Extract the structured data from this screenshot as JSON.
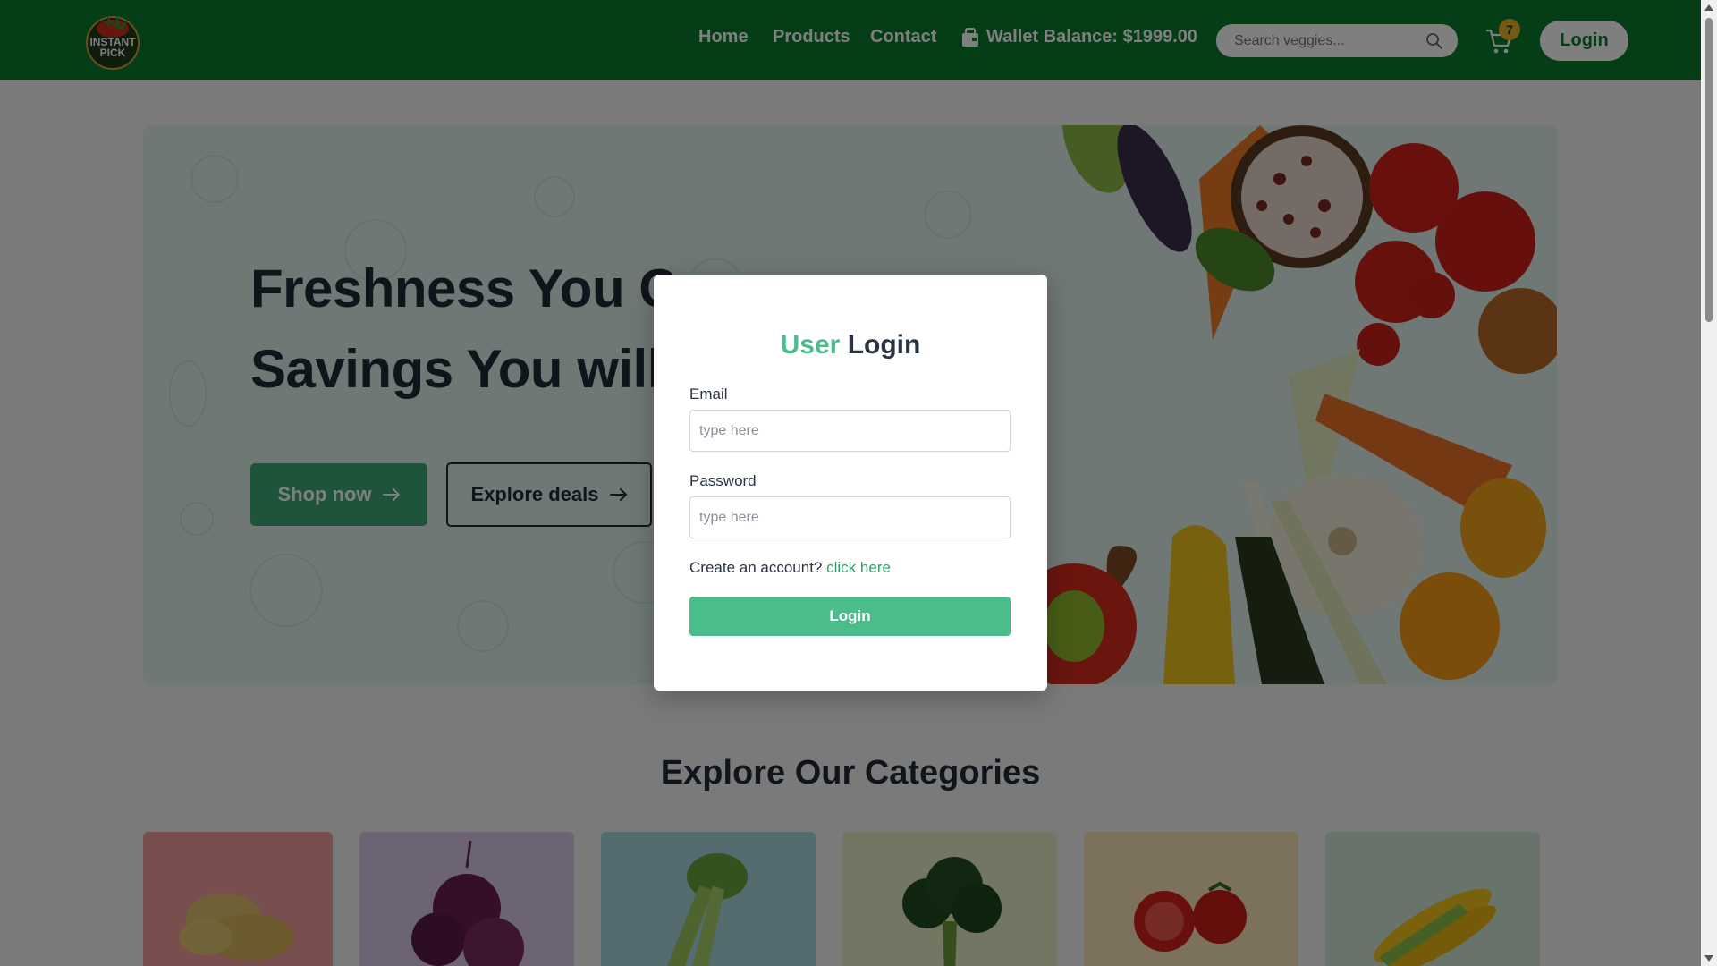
{
  "nav": {
    "logo_text_line1": "INSTANT",
    "logo_text_line2": "PICK",
    "links": [
      "Home",
      "Products",
      "Contact"
    ],
    "wallet_label": "Wallet Balance: $1999.00",
    "search_placeholder": "Search veggies...",
    "cart_count": "7",
    "login_label": "Login"
  },
  "hero": {
    "line1": "Freshness You Can",
    "line2": "Savings You will Love",
    "shop_label": "Shop now",
    "deals_label": "Explore deals"
  },
  "categories": {
    "heading": "Explore Our Categories",
    "cards": [
      {
        "item": "potato",
        "color": "#f29d9d"
      },
      {
        "item": "onion",
        "color": "#d9c8ea"
      },
      {
        "item": "celery",
        "color": "#a8d7de"
      },
      {
        "item": "broccoli",
        "color": "#e6ecc6"
      },
      {
        "item": "tomato",
        "color": "#f6e2b8"
      },
      {
        "item": "corn",
        "color": "#cfe7d6"
      }
    ]
  },
  "modal": {
    "title_accent": "User",
    "title_rest": "Login",
    "email_label": "Email",
    "email_placeholder": "type here",
    "password_label": "Password",
    "password_placeholder": "type here",
    "create_text": "Create an account?",
    "create_link": "click here",
    "login_label": "Login"
  },
  "colors": {
    "nav_bg": "#0a7a2f",
    "accent": "#4bbd8b",
    "cart_badge": "#e8b428"
  },
  "icons": [
    "logo-icon",
    "wallet-icon",
    "search-icon",
    "cart-icon",
    "arrow-right-icon"
  ]
}
